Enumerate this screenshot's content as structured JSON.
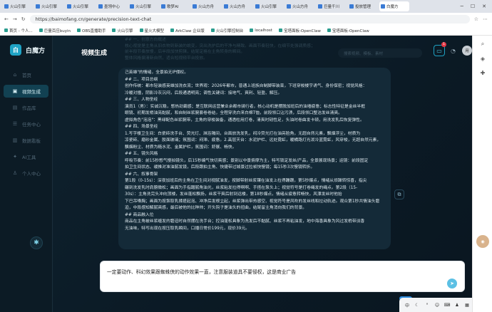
{
  "browser": {
    "tabs": [
      {
        "label": "火山引擎"
      },
      {
        "label": "火山引擎"
      },
      {
        "label": "火山引擎"
      },
      {
        "label": "墨翎中心"
      },
      {
        "label": "火山引擎"
      },
      {
        "label": "歌梦AI"
      },
      {
        "label": "火山方舟"
      },
      {
        "label": "火山方舟"
      },
      {
        "label": "火山引擎"
      },
      {
        "label": "火山方舟"
      },
      {
        "label": "巨量千川"
      },
      {
        "label": "投放管理"
      },
      {
        "label": "白魔方"
      }
    ],
    "url": "https://baimofang.cn/generate/precision-text-chat",
    "bookmarks": [
      "首页 - 个人...",
      "巨量百应buyin",
      "OBS直播助手",
      "火山引擎",
      "星火大模型",
      "ArkClaw 企业版",
      "火山引擎控制台",
      "localhost",
      "宝塔面板-OpenClaw",
      "宝塔面板-OpenClaw"
    ]
  },
  "app": {
    "brand": "白魔方",
    "nav": [
      {
        "label": "首页",
        "icon": "home-icon"
      },
      {
        "label": "视频生成",
        "icon": "video-icon",
        "active": true
      },
      {
        "label": "作品库",
        "icon": "library-icon"
      },
      {
        "label": "任务中心",
        "icon": "task-icon"
      },
      {
        "label": "数据看板",
        "icon": "chart-icon"
      },
      {
        "label": "AI工具",
        "icon": "ai-icon"
      },
      {
        "label": "个人中心",
        "icon": "user-icon"
      }
    ],
    "page_title": "视频生成",
    "header_search_placeholder": "搜索视频、模板、素材",
    "notification_count": "1",
    "avatar_initials": "用",
    "faded_lines": [
      "## 一、创意方向概述",
      "核心视觉是主角从旧衣物到新装的蜕变，突出洗护后的干净与精致。画面节奏轻快，在细节处强调质感；",
      "前半段节奏放慢，后半段加快剪辑，结尾定格在主角转身的瞬间。",
      "整体风格偏清新自然，适合短视频平台投放。"
    ],
    "message_lines": [
      "己英雄\"的情绪，全景拍无IP侵权。",
      "## 二、项目总纲",
      "创作传统：都市轻装感英雄加洗衣流；世界观：2026年都市，普通上班族自制脚带装束，下班穿梭楼宇诱气、身份保密；视觉风格：",
      "冷暖对撞，阴影冷灰沉闷，后段通透明亮；调性关键词：接地气、爽利、轻盈、解压。",
      "## 三、人物圣经",
      "演员1（男）：实诚沉稳，憋热劲霸感；是互联网运营兼业余都市骑行者，核心动机是摆脱加班后的油墙疲惫；标志性特征是金丝半框",
      "眼镜、初期发梢油亮黏腻，和自制丝浆腕套卷卷结，全程穿洗白来白棉T恤，前段领口沾污渍，后段领口整洁发丝清爽。",
      "虚拟角色\"泡泡\"：黑绿配色丝浆腕带，主角的穿梭装备，通透柱用打卷，清爽时韧性足，头油时卷曲发卡顿，用洗发乳后恢复弹性。",
      "## 四、场景圣经",
      "1.写字楼卫生间：白瓷砖洗手台、荧光灯、淋浴隔间，台面放洗发乳，闷冷荧光打在油亮脸角，无超自然元素，飘烟浮尘，材质为",
      "凉瓷砖、磨砂金属、胶面玻璃；氛围词：闷滞、疲惫。2.高层天台：水泥护栏、远处霓虹，暖橘路灯光泼冷蓝霓虹，风穿梭，无超自然元素，",
      "飘烟粉尘、材质为糙水泥、金属护栏，氛围词：舒展、畅快。",
      "## 五、镜头风格",
      "呼吸节奏：前15秒憋气慢拍镜头，后15秒编气快切爽感；景别以中景俯摩为主，特写锁定发丝/产品，全景展现场景；运镜：前段固定",
      "拍卫生间状态、缓推对准油腻发镜，后段跟拍主角、快捷带过城景过拉帧快慢镜；每15秒3次慢镜转折。",
      "## 六、叙事骨架",
      "第1段（0-15s）：深夜加班后的主角在卫生间对视腻油发，按脚带射丝浆镶在油发上拉得蹦跚，第5秒爆点，情绪从烦躁转惊喜，指尖",
      "碾到洗发乳时肩膀微松；画面为手指蹭腻角油光，丝浆粘发拉得啊啊、手搭在泵头上；视觉符号是打卷绳发的绳点。第2段（15-",
      "30s）：主角洗完头冲向顶楼，发丝蓬松飘扬，丝浆干爽后射到远楼，第18秒爆点，情绪从疲惫转畅快，风漂发丝时他抬",
      "下巴吊嗓胸；画面为按泵取乳揉搓起泡、冲净后发根立起，丝浆弹出带热感空、视觉符号是风吹的发丝线和拉动轨迹。观众第1秒共情油头窘",
      "迫，中段感知解腻爽感，最后被他的比种帅；开头钩子是油头的扭曲，结尾留主角消向我们的背景。",
      "## 商品融入位",
      "商品在主角被丝浆缠发的窘迫时自然摆在洗手台；控油蓬松具象为洗发后不黏腻、丝浆不再粘油发，地中海香具象为风过发梢带淡香",
      "无油味，特写出现在按压取乳瞬间，口播日常价199元，现价39元。"
    ],
    "input_text": "一定要动作、科幻效果跟蜘蛛侠的动作效果一直，注意服装道具不要侵权，这是商业广告"
  }
}
